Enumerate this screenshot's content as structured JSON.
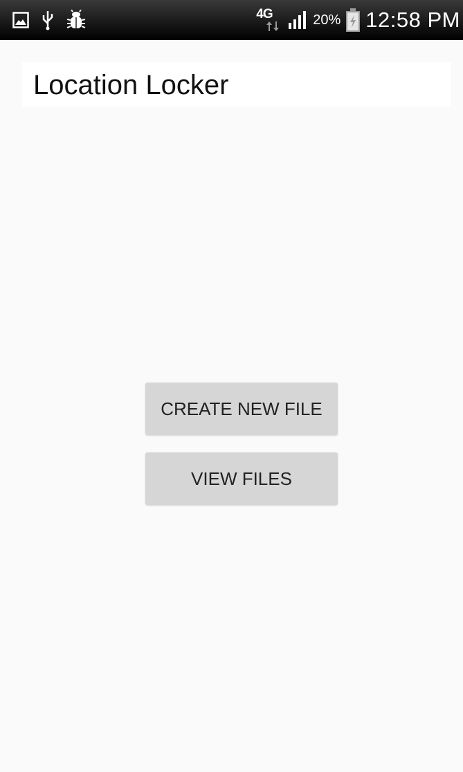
{
  "status_bar": {
    "icons_left": [
      "gallery-icon",
      "usb-icon",
      "bug-icon"
    ],
    "network_type": "4G",
    "signal_icon": "signal-bars-icon",
    "battery_percent": "20%",
    "battery_icon": "battery-charging-icon",
    "time": "12:58 PM"
  },
  "app": {
    "title": "Location Locker"
  },
  "main": {
    "create_button_label": "CREATE NEW FILE",
    "view_button_label": "VIEW FILES"
  },
  "colors": {
    "status_bar_bg": "#111111",
    "background": "#fafafa",
    "title_bg": "#ffffff",
    "button_bg": "#d6d6d6",
    "button_text": "#222222"
  }
}
